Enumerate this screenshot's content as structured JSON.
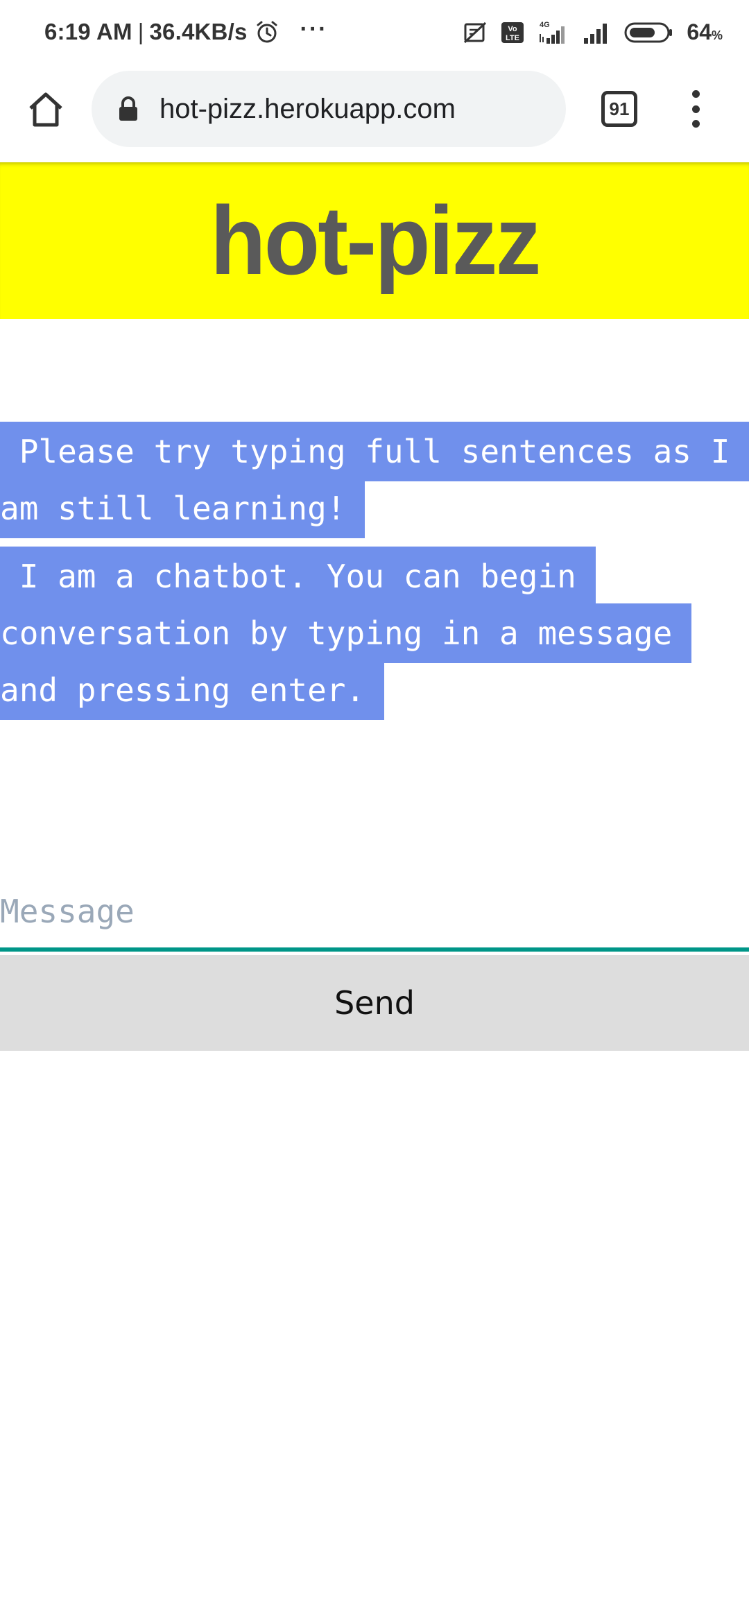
{
  "status_bar": {
    "time": "6:19 AM",
    "separator": "|",
    "network_speed": "36.4KB/s",
    "more_indicator": "···",
    "battery_percent": "64",
    "battery_unit": "%",
    "icons": [
      "alarm-icon",
      "no-sim-icon",
      "volte-icon",
      "signal-4g-icon",
      "signal-icon",
      "battery-icon"
    ]
  },
  "browser": {
    "url": "hot-pizz.herokuapp.com",
    "tab_count": "91",
    "icons": [
      "home-icon",
      "lock-icon",
      "tabs-icon",
      "menu-icon"
    ]
  },
  "header": {
    "title": "hot-pizz",
    "background_color": "#ffff00",
    "title_color": "#5a5a5a"
  },
  "messages": [
    {
      "text": " Please try typing full sentences as I am still learning! "
    },
    {
      "text": " I am a chatbot. You can begin conversation by typing in a message and pressing enter. "
    }
  ],
  "bubble_color": "#7090ec",
  "composer": {
    "placeholder": "Message",
    "value": "",
    "send_label": "Send",
    "underline_color": "#009688"
  }
}
